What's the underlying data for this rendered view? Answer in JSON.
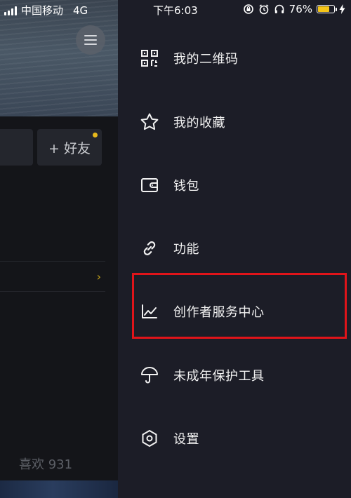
{
  "status_bar": {
    "carrier": "中国移动",
    "network": "4G",
    "time": "下午6:03",
    "battery_percent": "76%",
    "battery_level": 0.76
  },
  "left_panel": {
    "add_friend_label": "+ 好友",
    "likes_text": "喜欢 931"
  },
  "drawer": {
    "items": [
      {
        "label": "我的二维码",
        "icon": "qr-code-icon"
      },
      {
        "label": "我的收藏",
        "icon": "star-icon"
      },
      {
        "label": "钱包",
        "icon": "wallet-icon"
      },
      {
        "label": "功能",
        "icon": "link-icon"
      },
      {
        "label": "创作者服务中心",
        "icon": "chart-icon"
      },
      {
        "label": "未成年保护工具",
        "icon": "umbrella-icon"
      },
      {
        "label": "设置",
        "icon": "settings-icon"
      }
    ]
  },
  "colors": {
    "drawer_bg": "#1c1d27",
    "highlight": "#e0141a",
    "accent_yellow": "#f5c518"
  }
}
